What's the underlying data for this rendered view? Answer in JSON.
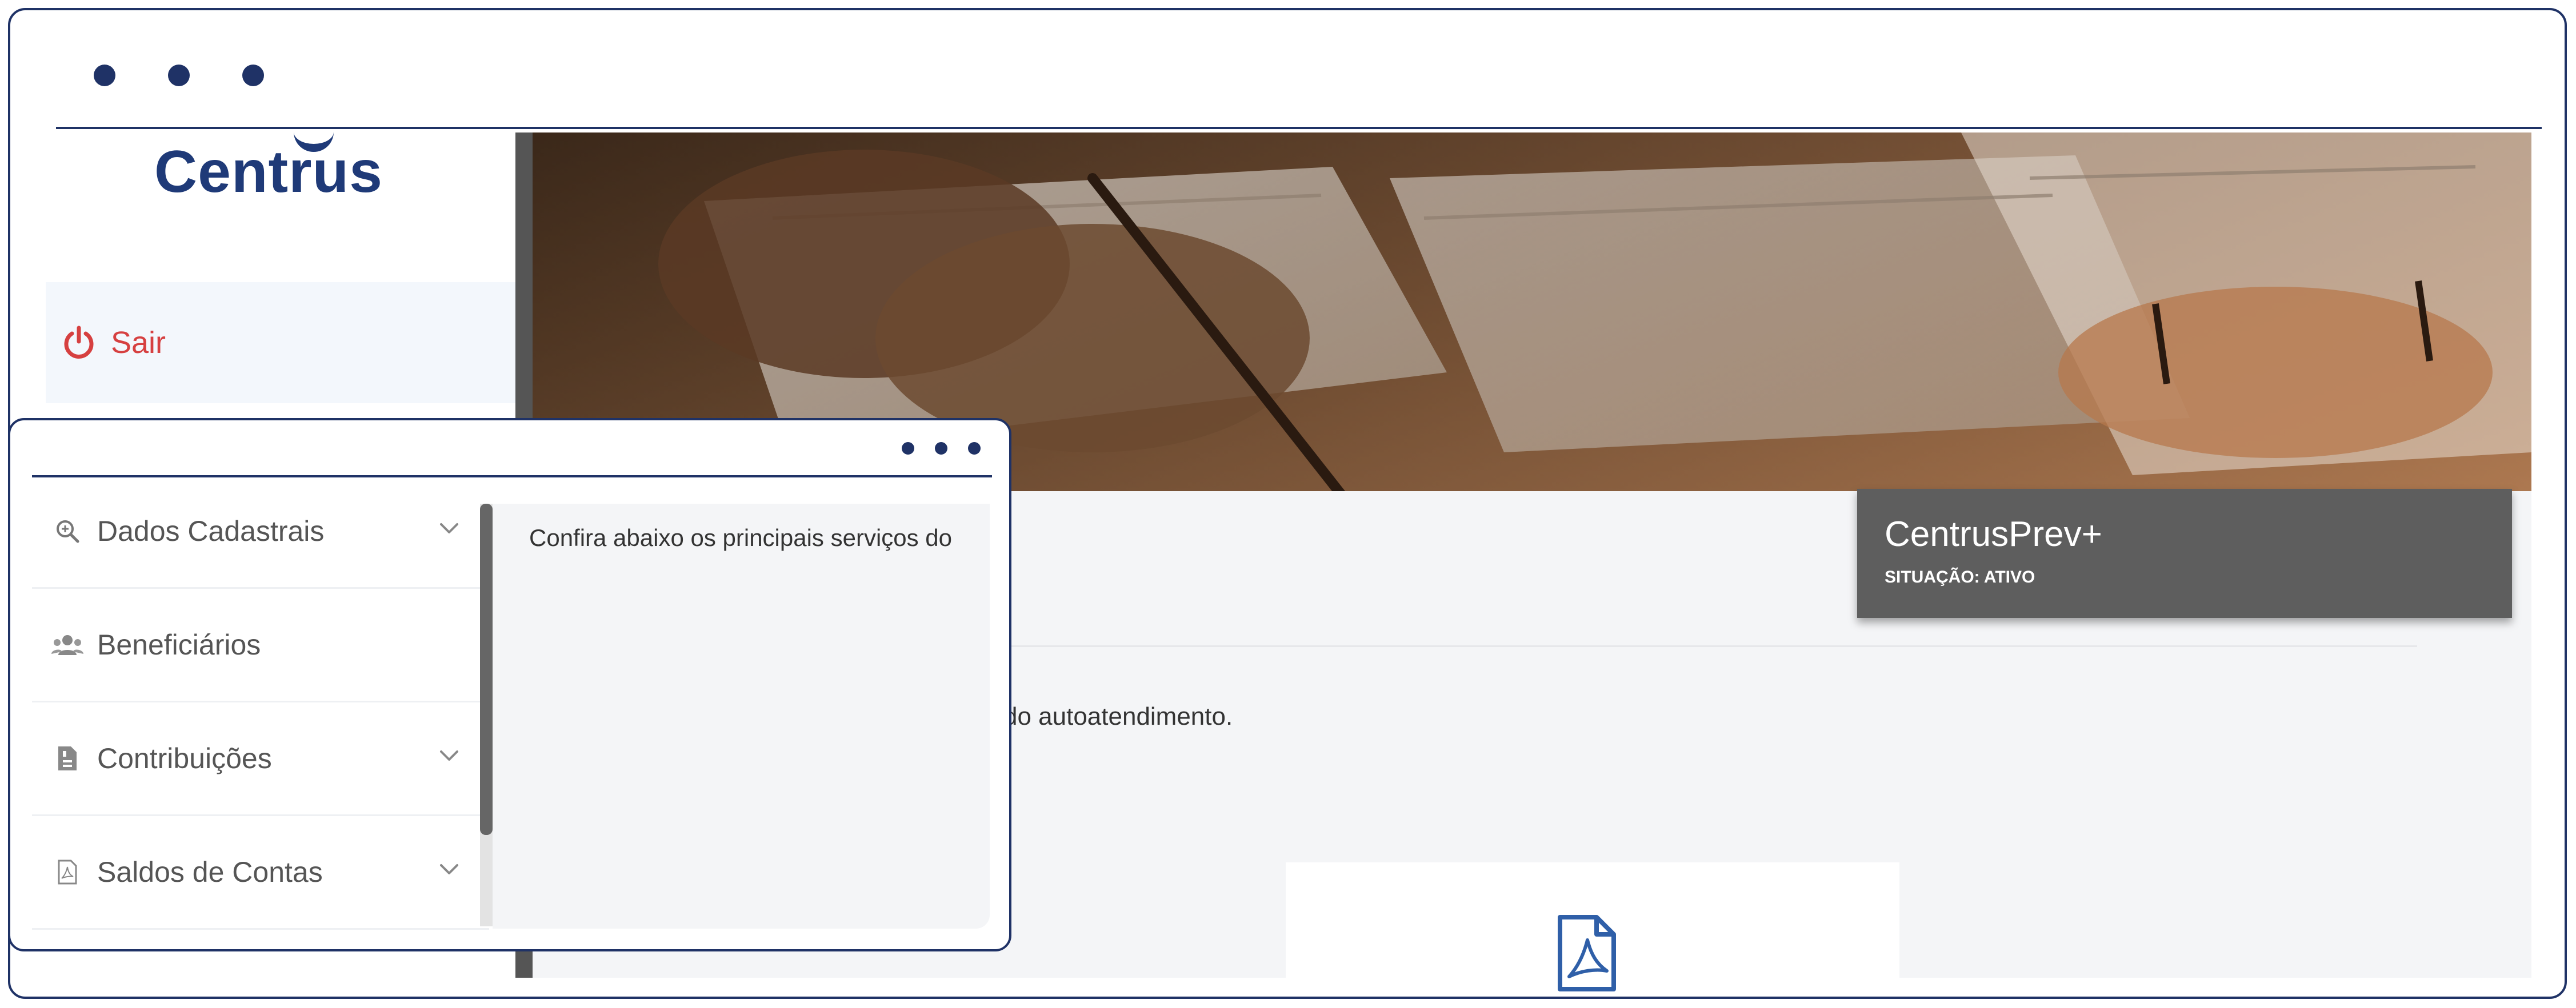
{
  "brand": {
    "logo_text": "Centrus"
  },
  "sidebar": {
    "logout_label": "Sair"
  },
  "menu": {
    "items": [
      {
        "label": "Dados Cadastrais",
        "icon": "search-icon",
        "has_chevron": true
      },
      {
        "label": "Beneficiários",
        "icon": "users-icon",
        "has_chevron": false
      },
      {
        "label": "Contribuições",
        "icon": "document-icon",
        "has_chevron": true
      },
      {
        "label": "Saldos de Contas",
        "icon": "pdf-file-icon",
        "has_chevron": true
      }
    ]
  },
  "plan": {
    "name": "CentrusPrev+",
    "status": "SITUAÇÃO: ATIVO"
  },
  "content": {
    "intro_start": "Confira abaixo os principais serviços do",
    "intro_end": "do autoatendimento."
  },
  "colors": {
    "frame": "#1f3266",
    "logout": "#d64040",
    "plan_card": "#5e5e5e",
    "pdf_icon": "#2f5fa8"
  },
  "icons": {
    "logout": "power-icon",
    "chevron": "chevron-down-icon",
    "document": "pdf-document-icon"
  }
}
